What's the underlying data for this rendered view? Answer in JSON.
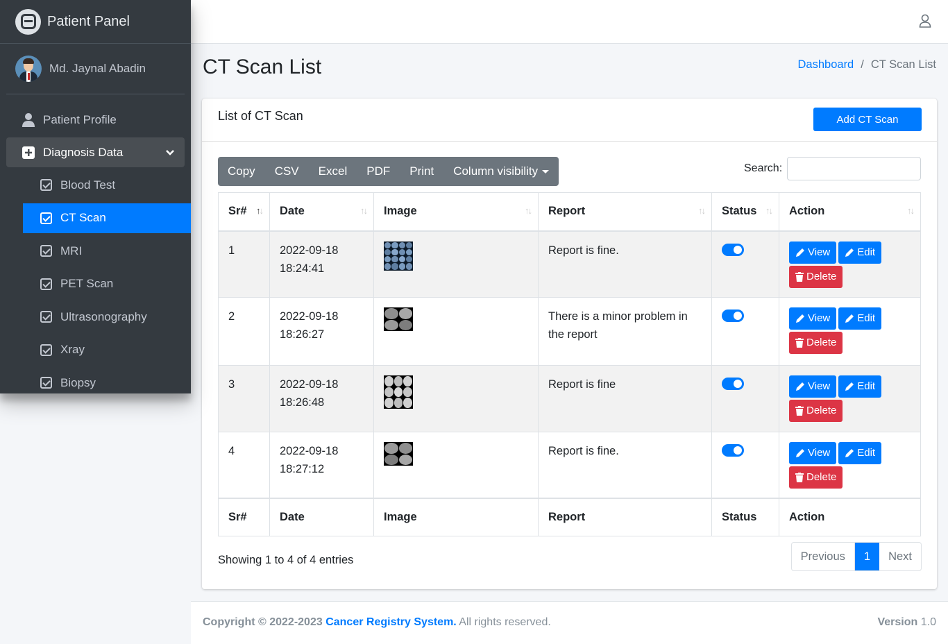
{
  "brand": {
    "title": "Patient Panel"
  },
  "user": {
    "name": "Md. Jaynal Abadin"
  },
  "sidebar": {
    "top_items": [
      {
        "label": "Patient Profile",
        "icon": "user-icon"
      },
      {
        "label": "Diagnosis Data",
        "icon": "plus-square-icon"
      }
    ],
    "sub_items": [
      {
        "label": "Blood Test"
      },
      {
        "label": "CT Scan"
      },
      {
        "label": "MRI"
      },
      {
        "label": "PET Scan"
      },
      {
        "label": "Ultrasonography"
      },
      {
        "label": "Xray"
      },
      {
        "label": "Biopsy"
      }
    ],
    "active_item": "CT Scan"
  },
  "page": {
    "title": "CT Scan List"
  },
  "breadcrumb": {
    "home": "Dashboard",
    "separator": "/",
    "current": "CT Scan List"
  },
  "card": {
    "title": "List of CT Scan",
    "add_button": "Add CT Scan"
  },
  "toolbar": {
    "buttons": [
      "Copy",
      "CSV",
      "Excel",
      "PDF",
      "Print",
      "Column visibility"
    ]
  },
  "search": {
    "label": "Search:",
    "value": ""
  },
  "table": {
    "columns": [
      "Sr#",
      "Date",
      "Image",
      "Report",
      "Status",
      "Action"
    ],
    "rows": [
      {
        "sr": "1",
        "date": "2022-09-18",
        "time": "18:24:41",
        "report": "Report is fine.",
        "status": true
      },
      {
        "sr": "2",
        "date": "2022-09-18",
        "time": "18:26:27",
        "report": "There is a minor problem in the report",
        "status": true
      },
      {
        "sr": "3",
        "date": "2022-09-18",
        "time": "18:26:48",
        "report": "Report is fine",
        "status": true
      },
      {
        "sr": "4",
        "date": "2022-09-18",
        "time": "18:27:12",
        "report": "Report is fine.",
        "status": true
      }
    ],
    "actions": {
      "view": "View",
      "edit": "Edit",
      "delete": "Delete"
    }
  },
  "info": {
    "text": "Showing 1 to 4 of 4 entries"
  },
  "pagination": {
    "previous": "Previous",
    "current": "1",
    "next": "Next"
  },
  "footer": {
    "copyright": "Copyright © 2022-2023",
    "org": "Cancer Registry System.",
    "rights": "All rights reserved.",
    "version_label": "Version",
    "version": "1.0"
  },
  "colors": {
    "primary": "#007bff",
    "danger": "#dc3545",
    "sidebar": "#343a40",
    "toolbar": "#6c757d"
  }
}
